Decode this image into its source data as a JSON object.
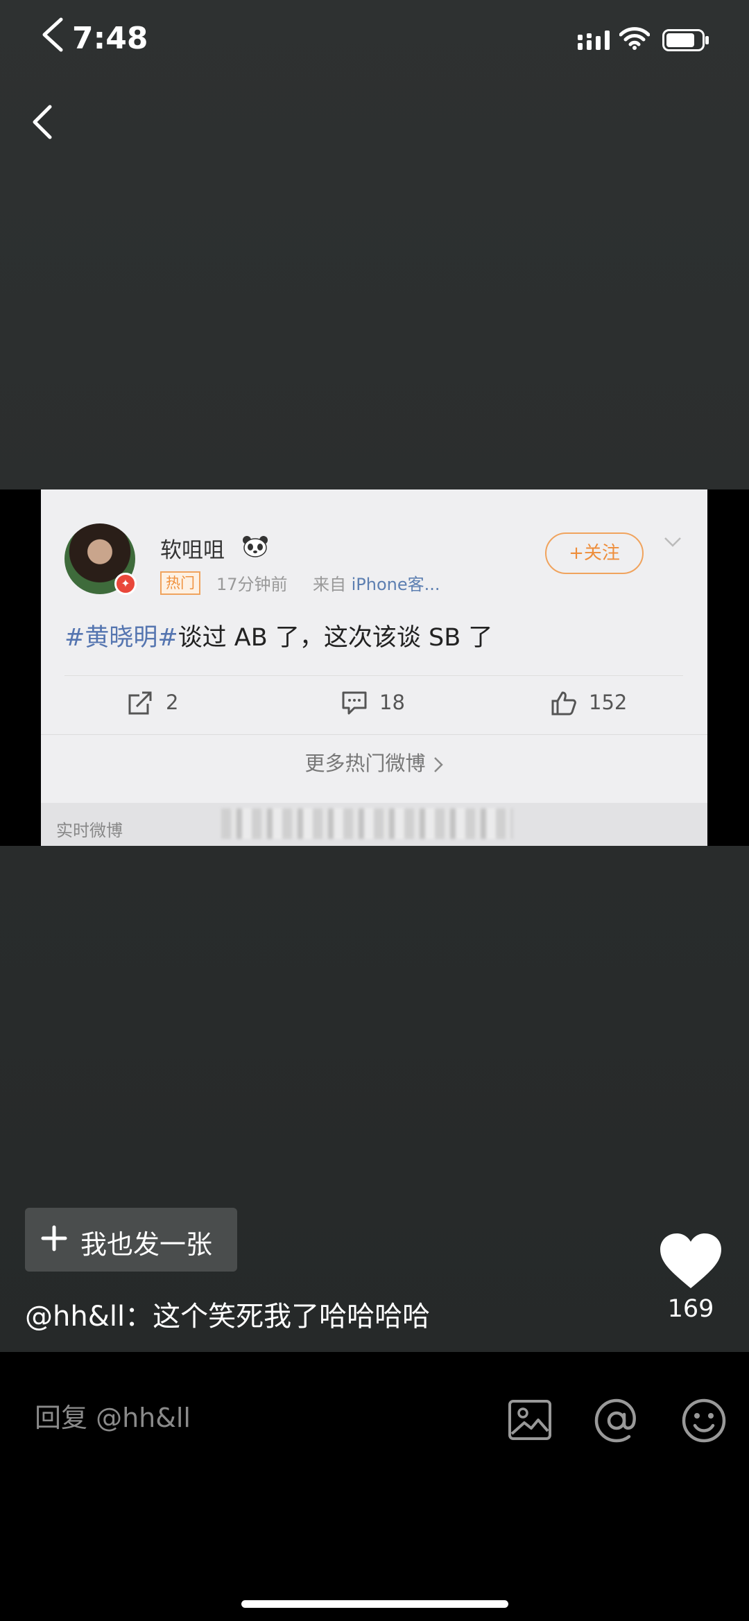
{
  "status_bar": {
    "time": "7:48"
  },
  "weibo_card": {
    "username": "软咀咀",
    "hot_badge": "热门",
    "post_time": "17分钟前",
    "source_prefix": "来自",
    "source_name": "iPhone客...",
    "follow_label": "+关注",
    "hashtag": "#黄晓明#",
    "post_body": "谈过 AB 了，这次该谈 SB 了",
    "repost_count": "2",
    "comment_count": "18",
    "like_count": "152",
    "more_hot": "更多热门微博",
    "realtime_label": "实时微博"
  },
  "overlay": {
    "post_too_label": "我也发一张",
    "comment": "@hh&ll：这个笑死我了哈哈哈哈",
    "likes": "169"
  },
  "reply": {
    "placeholder": "回复 @hh&ll"
  },
  "colors": {
    "page_bg": "#2b2e2e",
    "tag_blue": "#5575b0",
    "follow_orange": "#ee8d3a",
    "verified_red": "#e9473a"
  }
}
